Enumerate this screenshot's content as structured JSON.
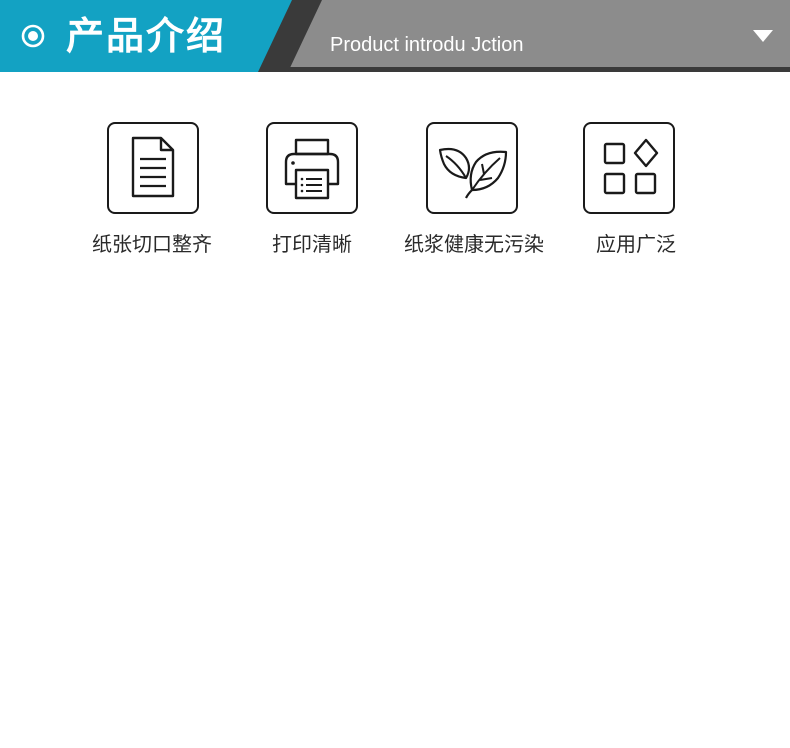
{
  "header": {
    "title": "产品介绍",
    "subtitle": "Product introdu Jction",
    "accent_color": "#13a2c3",
    "gray_color": "#8c8c8c",
    "dark_color": "#3a3a3a",
    "icons": {
      "left": "target-icon",
      "right": "dropdown-arrow-icon"
    }
  },
  "features": [
    {
      "icon": "document-icon",
      "label": "纸张切口整齐"
    },
    {
      "icon": "printer-icon",
      "label": "打印清晰"
    },
    {
      "icon": "leaves-icon",
      "label": "纸浆健康无污染"
    },
    {
      "icon": "apps-grid-icon",
      "label": "应用广泛"
    }
  ]
}
